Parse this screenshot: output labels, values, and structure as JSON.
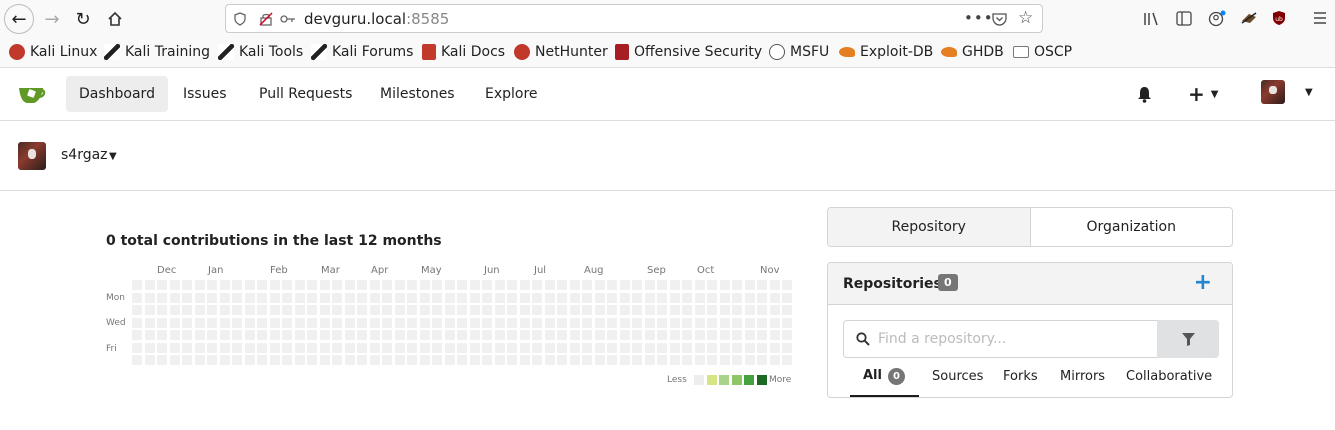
{
  "browser": {
    "url_host": "devguru.local",
    "url_port": ":8585"
  },
  "bookmarks": [
    {
      "label": "Kali Linux",
      "color": "#c0392b"
    },
    {
      "label": "Kali Training",
      "color": "#222222"
    },
    {
      "label": "Kali Tools",
      "color": "#222222"
    },
    {
      "label": "Kali Forums",
      "color": "#222222"
    },
    {
      "label": "Kali Docs",
      "color": "#c0392b"
    },
    {
      "label": "NetHunter",
      "color": "#c0392b"
    },
    {
      "label": "Offensive Security",
      "color": "#a61d24"
    },
    {
      "label": "MSFU",
      "color": "#555555"
    },
    {
      "label": "Exploit-DB",
      "color": "#e67e22"
    },
    {
      "label": "GHDB",
      "color": "#e67e22"
    },
    {
      "label": "OSCP",
      "color": "#888888"
    }
  ],
  "nav": {
    "items": [
      {
        "label": "Dashboard",
        "active": true
      },
      {
        "label": "Issues",
        "active": false
      },
      {
        "label": "Pull Requests",
        "active": false
      },
      {
        "label": "Milestones",
        "active": false
      },
      {
        "label": "Explore",
        "active": false
      }
    ],
    "accent": "#609926"
  },
  "context": {
    "username": "s4rgaz"
  },
  "heatmap": {
    "title": "0 total contributions in the last 12 months",
    "months": [
      "Dec",
      "Jan",
      "Feb",
      "Mar",
      "Apr",
      "May",
      "Jun",
      "Jul",
      "Aug",
      "Sep",
      "Oct",
      "Nov"
    ],
    "days": [
      "Mon",
      "Wed",
      "Fri"
    ],
    "legend_less": "Less",
    "legend_more": "More",
    "legend_colors": [
      "#ededed",
      "#d6e685",
      "#a9d38a",
      "#8cc665",
      "#44a340",
      "#1e6823"
    ]
  },
  "panel": {
    "switch_repo": "Repository",
    "switch_org": "Organization",
    "repos_title": "Repositories",
    "repos_count": "0",
    "search_placeholder": "Find a repository...",
    "tabs": [
      {
        "label": "All",
        "badge": "0"
      },
      {
        "label": "Sources"
      },
      {
        "label": "Forks"
      },
      {
        "label": "Mirrors"
      },
      {
        "label": "Collaborative"
      }
    ]
  }
}
